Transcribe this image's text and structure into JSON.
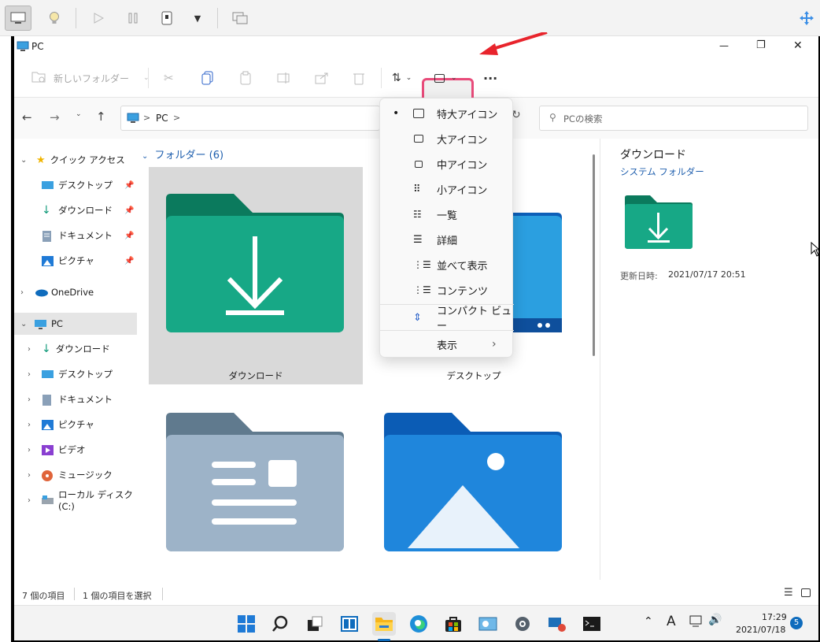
{
  "vm_toolbar": {
    "buttons": [
      "monitor-icon",
      "lightbulb-icon",
      "play-icon",
      "pause-icon",
      "usb-icon",
      "dropdown-icon",
      "screens-icon",
      "move-icon"
    ]
  },
  "window": {
    "title": "PC",
    "minimize": "—",
    "restore": "❐",
    "close": "✕"
  },
  "toolbar": {
    "new_folder": "新しいフォルダー",
    "more": "···"
  },
  "address": {
    "path_root": "PC",
    "sep": ">",
    "search_placeholder": "PCの検索"
  },
  "sidebar": {
    "quick_access": "クイック アクセス",
    "quick_items": [
      "デスクトップ",
      "ダウンロード",
      "ドキュメント",
      "ピクチャ"
    ],
    "onedrive": "OneDrive",
    "pc": "PC",
    "pc_items": [
      "ダウンロード",
      "デスクトップ",
      "ドキュメント",
      "ピクチャ",
      "ビデオ",
      "ミュージック",
      "ローカル ディスク (C:)"
    ]
  },
  "content": {
    "group_header": "フォルダー (6)",
    "items": [
      "ダウンロード",
      "デスクトップ"
    ]
  },
  "view_menu": {
    "items": [
      "特大アイコン",
      "大アイコン",
      "中アイコン",
      "小アイコン",
      "一覧",
      "詳細",
      "並べて表示",
      "コンテンツ",
      "コンパクト ビュー",
      "表示"
    ],
    "selected_bullet": "•",
    "submenu_arrow": "›"
  },
  "details": {
    "name": "ダウンロード",
    "type": "システム フォルダー",
    "modified_label": "更新日時:",
    "modified_value": "2021/07/17 20:51"
  },
  "status": {
    "count": "7 個の項目",
    "selected": "1 個の項目を選択"
  },
  "taskbar": {
    "time": "17:29",
    "date": "2021/07/18",
    "notifications": "5",
    "ime": "A"
  },
  "colors": {
    "accent": "#0067c0",
    "highlight": "#e84b7a",
    "arrow": "#e8242c",
    "folder_green": "#0f9d7c"
  }
}
